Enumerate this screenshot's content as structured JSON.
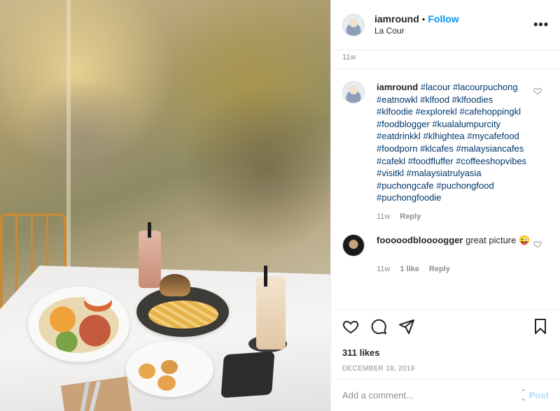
{
  "post": {
    "username": "iamround",
    "separator": "•",
    "follow_label": "Follow",
    "location": "La Cour",
    "more_label": "•••",
    "top_timestamp": "11w"
  },
  "caption": {
    "username": "iamround",
    "tags": "#lacour #lacourpuchong #eatnowkl #klfood #klfoodies #klfoodie #explorekl #cafehoppingkl #foodblogger #kualalumpurcity #eatdrinkkl #klhightea #mycafefood #foodporn #klcafes #malaysiancafes #cafekl #foodfluffer #coffeeshopvibes #visitkl #malaysiatrulyasia #puchongcafe #puchongfood #puchongfoodie",
    "time": "11w",
    "reply_label": "Reply"
  },
  "comments": [
    {
      "username": "fooooodbloooogger",
      "text": "great picture 😜",
      "time": "11w",
      "likes_label": "1 like",
      "reply_label": "Reply"
    }
  ],
  "actions": {
    "like_icon": "heart-icon",
    "comment_icon": "comment-icon",
    "share_icon": "send-icon",
    "save_icon": "bookmark-icon"
  },
  "likes": "311 likes",
  "date": "DECEMBER 18, 2019",
  "add_comment": {
    "placeholder": "Add a comment...",
    "post_label": "Post"
  },
  "colors": {
    "accent": "#0095f6",
    "hashtag": "#00376b",
    "muted": "#8e8e8e",
    "post_disabled": "#b2dffc"
  }
}
